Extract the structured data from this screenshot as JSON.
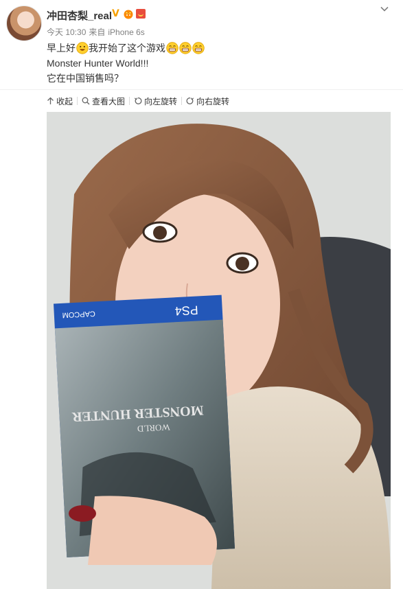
{
  "post": {
    "user_name": "冲田杏梨_real",
    "time": "今天 10:30",
    "source_prefix": "来自",
    "source": "iPhone 6s",
    "line1_before": "早上好",
    "line1_after": "我开始了这个游戏",
    "line2": "Monster Hunter World!!!",
    "line3": "它在中国销售吗？"
  },
  "actions": {
    "collapse": "收起",
    "view_large": "查看大图",
    "rotate_left": "向左旋转",
    "rotate_right": "向右旋转"
  },
  "photo_text": {
    "platform": "PS4",
    "publisher": "CAPCOM",
    "title_line1": "MONSTER HUNTER",
    "title_line2": "WORLD"
  },
  "icons": {
    "verified": "verified-v-icon",
    "crown": "crown-badge-icon",
    "red_badge": "red-envelope-badge-icon",
    "more": "chevron-down-icon",
    "emoji": "grin-emoji-icon"
  },
  "colors": {
    "accent_orange": "#f7a000",
    "text_main": "#333333",
    "text_meta": "#808080"
  }
}
